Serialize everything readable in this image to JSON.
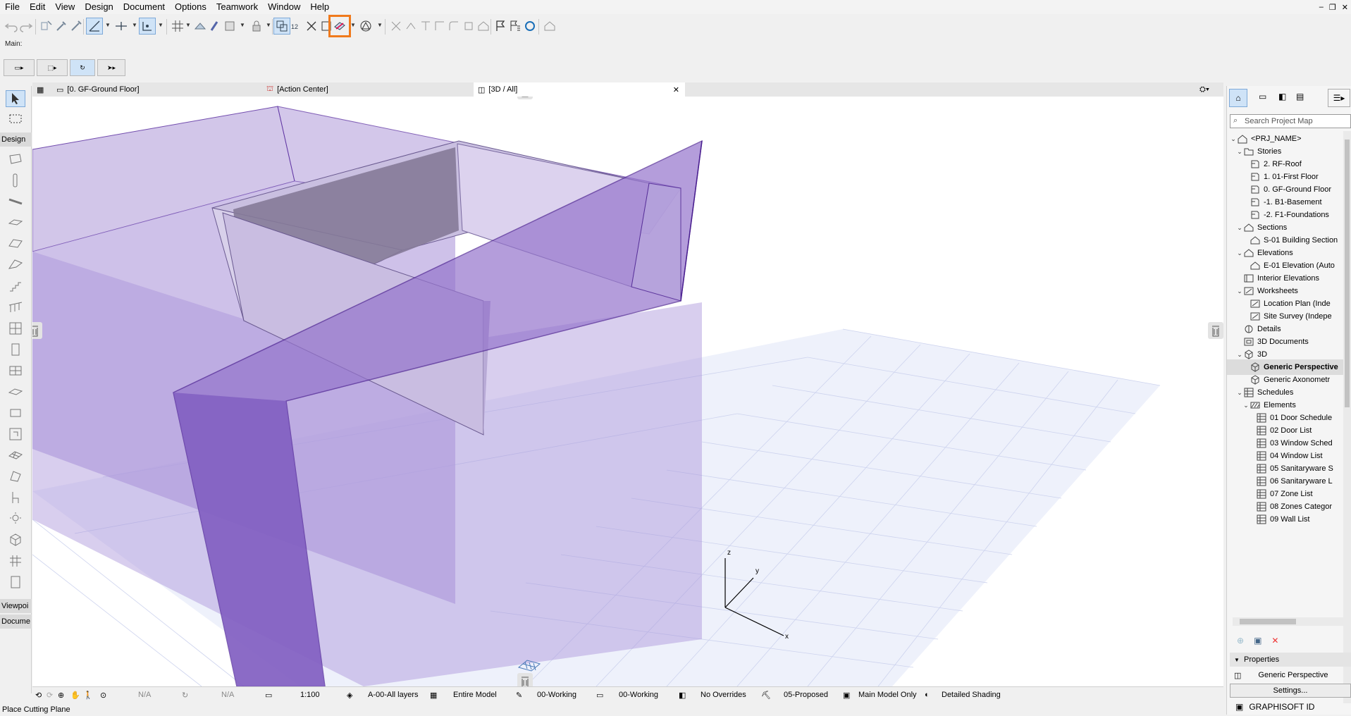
{
  "menu": [
    "File",
    "Edit",
    "View",
    "Design",
    "Document",
    "Options",
    "Teamwork",
    "Window",
    "Help"
  ],
  "window_controls": [
    "minimize-glyph",
    "restore-glyph",
    "close-glyph"
  ],
  "toolbar": {
    "main_label": "Main:"
  },
  "tabs": [
    {
      "label": "[0. GF-Ground Floor]",
      "active": false
    },
    {
      "label": "[Action Center]",
      "active": false
    },
    {
      "label": "[3D / All]",
      "active": true
    }
  ],
  "toolbox": {
    "design_label": "Design",
    "viewpoint_label": "Viewpoi",
    "document_label": "Docume"
  },
  "navigator": {
    "search_placeholder": "Search Project Map",
    "tree": [
      {
        "label": "<PRJ_NAME>",
        "level": 0,
        "chev": "v",
        "icon": "project"
      },
      {
        "label": "Stories",
        "level": 1,
        "chev": "v",
        "icon": "folder"
      },
      {
        "label": "2. RF-Roof",
        "level": 2,
        "chev": "",
        "icon": "story"
      },
      {
        "label": "1. 01-First Floor",
        "level": 2,
        "chev": "",
        "icon": "story"
      },
      {
        "label": "0. GF-Ground Floor",
        "level": 2,
        "chev": "",
        "icon": "story"
      },
      {
        "label": "-1. B1-Basement",
        "level": 2,
        "chev": "",
        "icon": "story"
      },
      {
        "label": "-2. F1-Foundations",
        "level": 2,
        "chev": "",
        "icon": "story"
      },
      {
        "label": "Sections",
        "level": 1,
        "chev": "v",
        "icon": "section"
      },
      {
        "label": "S-01 Building Section",
        "level": 2,
        "chev": "",
        "icon": "section"
      },
      {
        "label": "Elevations",
        "level": 1,
        "chev": "v",
        "icon": "section"
      },
      {
        "label": "E-01 Elevation (Auto",
        "level": 2,
        "chev": "",
        "icon": "section"
      },
      {
        "label": "Interior Elevations",
        "level": 1,
        "chev": "",
        "icon": "interior"
      },
      {
        "label": "Worksheets",
        "level": 1,
        "chev": "v",
        "icon": "worksheet"
      },
      {
        "label": "Location Plan (Inde",
        "level": 2,
        "chev": "",
        "icon": "worksheet"
      },
      {
        "label": "Site Survey (Indepe",
        "level": 2,
        "chev": "",
        "icon": "worksheet"
      },
      {
        "label": "Details",
        "level": 1,
        "chev": "",
        "icon": "detail"
      },
      {
        "label": "3D Documents",
        "level": 1,
        "chev": "",
        "icon": "doc3d"
      },
      {
        "label": "3D",
        "level": 1,
        "chev": "v",
        "icon": "cube"
      },
      {
        "label": "Generic Perspective",
        "level": 2,
        "chev": "",
        "icon": "cube",
        "selected": true
      },
      {
        "label": "Generic Axonometr",
        "level": 2,
        "chev": "",
        "icon": "cube"
      },
      {
        "label": "Schedules",
        "level": 1,
        "chev": "v",
        "icon": "grid"
      },
      {
        "label": "Elements",
        "level": 2,
        "chev": "v",
        "icon": "hatch"
      },
      {
        "label": "01 Door Schedule",
        "level": 3,
        "chev": "",
        "icon": "grid"
      },
      {
        "label": "02 Door List",
        "level": 3,
        "chev": "",
        "icon": "grid"
      },
      {
        "label": "03 Window Sched",
        "level": 3,
        "chev": "",
        "icon": "grid"
      },
      {
        "label": "04 Window List",
        "level": 3,
        "chev": "",
        "icon": "grid"
      },
      {
        "label": "05 Sanitaryware S",
        "level": 3,
        "chev": "",
        "icon": "grid"
      },
      {
        "label": "06 Sanitaryware L",
        "level": 3,
        "chev": "",
        "icon": "grid"
      },
      {
        "label": "07 Zone List",
        "level": 3,
        "chev": "",
        "icon": "grid"
      },
      {
        "label": "08 Zones Categor",
        "level": 3,
        "chev": "",
        "icon": "grid"
      },
      {
        "label": "09 Wall List",
        "level": 3,
        "chev": "",
        "icon": "grid"
      }
    ],
    "properties_label": "Properties",
    "properties_value": "Generic Perspective",
    "settings_label": "Settings...",
    "graphisoft_label": "GRAPHISOFT ID"
  },
  "quickbar": {
    "zoom_value": "N/A",
    "zoom2_value": "N/A",
    "scale": "1:100",
    "layers": "A-00-All layers",
    "model_filter": "Entire Model",
    "pen_set": "00-Working",
    "mvo": "00-Working",
    "graphic_override": "No Overrides",
    "renovation": "05-Proposed",
    "model_only": "Main Model Only",
    "shading": "Detailed Shading"
  },
  "axes": {
    "x": "x",
    "y": "y",
    "z": "z"
  },
  "status": "Place Cutting Plane",
  "colors": {
    "accent_highlight": "#f07a1c",
    "selection": "#dcdcdc",
    "model_purple": "#8a6cc4"
  }
}
